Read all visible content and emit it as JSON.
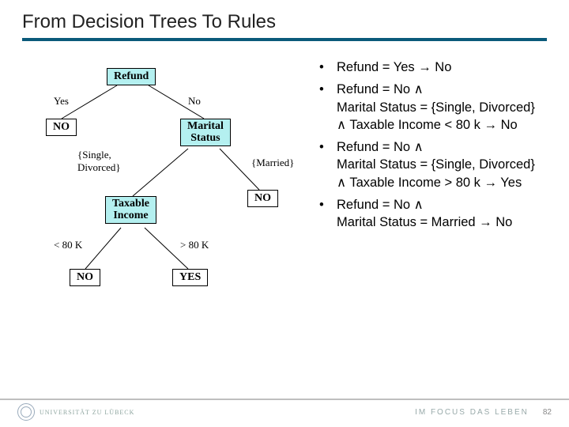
{
  "title": "From Decision Trees To Rules",
  "tree": {
    "root": {
      "label": "Refund"
    },
    "root_left": "Yes",
    "root_right": "No",
    "leaf_no1": "NO",
    "marital": {
      "label": "Marital",
      "label2": "Status"
    },
    "marital_left": "{Single,\nDivorced}",
    "marital_right": "{Married}",
    "leaf_no2": "NO",
    "taxable": {
      "label": "Taxable",
      "label2": "Income"
    },
    "tax_left": "< 80 K",
    "tax_right": "> 80 K",
    "leaf_no3": "NO",
    "leaf_yes": "YES"
  },
  "rules": [
    "Refund = Yes   →   No",
    "Refund = No ∧\nMarital Status = {Single, Divorced} ∧ Taxable Income < 80 k   →   No",
    "Refund = No ∧\nMarital Status = {Single, Divorced} ∧ Taxable Income > 80 k   →   Yes",
    "Refund = No ∧\nMarital Status = Married   →   No"
  ],
  "footer": {
    "uni": "UNIVERSITÄT ZU LÜBECK",
    "motto": "IM FOCUS DAS LEBEN",
    "page": "82"
  }
}
